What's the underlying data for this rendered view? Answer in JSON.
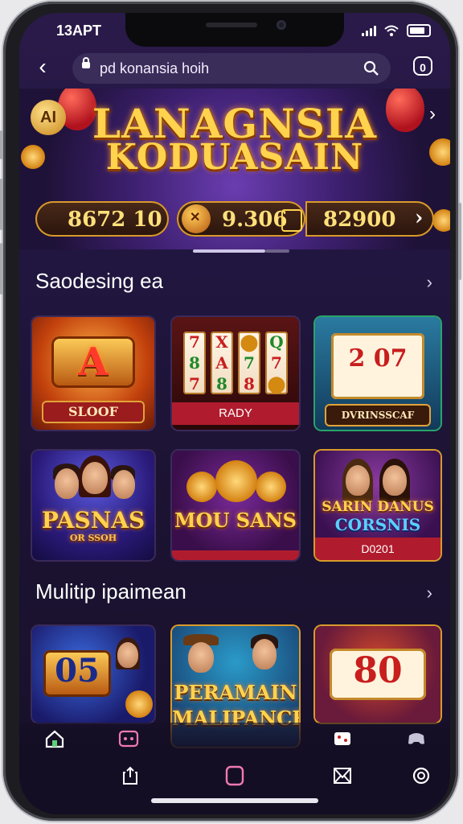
{
  "status_bar": {
    "time": "13APT"
  },
  "browser": {
    "url": "pd konansia hoih",
    "tabs_count": "0"
  },
  "hero": {
    "title_line1": "LANAGNSIA",
    "title_line2": "KODUASAIN",
    "stats": [
      "8672 10",
      "9.306",
      "82900"
    ]
  },
  "sections": [
    {
      "title": "Saodesing ea",
      "tiles": [
        {
          "label": "SLOOF",
          "art_text": "A"
        },
        {
          "label": "RADY",
          "reels": [
            "7",
            "X",
            "7",
            "8",
            "Q",
            "7"
          ]
        },
        {
          "label": "DVRINSSCAF",
          "art_text": "2 07"
        }
      ]
    },
    {
      "tiles": [
        {
          "label": "PASNAS",
          "sub": "OR SSOH"
        },
        {
          "label": "MOU SANS"
        },
        {
          "label": "D0201",
          "art_text": "SARIN DANUS",
          "sub": "CORSNIS"
        }
      ]
    },
    {
      "title": "Mulitip ipaimean",
      "tiles": [
        {
          "label": "",
          "art_text": "05"
        },
        {
          "label": "PERAMAIN",
          "sub": "MALIPANCR"
        },
        {
          "label": "",
          "art_text": "80"
        }
      ]
    }
  ],
  "colors": {
    "accent_gold": "#ffd34d",
    "label_red": "#b01c2e",
    "bg": "#1c1333"
  },
  "icons": {
    "bottom_row1": [
      "home-icon",
      "game-icon",
      "dice-icon",
      "gamepad-icon"
    ],
    "bottom_row2": [
      "share-icon",
      "tabs-icon",
      "mail-icon",
      "refresh-icon"
    ]
  }
}
